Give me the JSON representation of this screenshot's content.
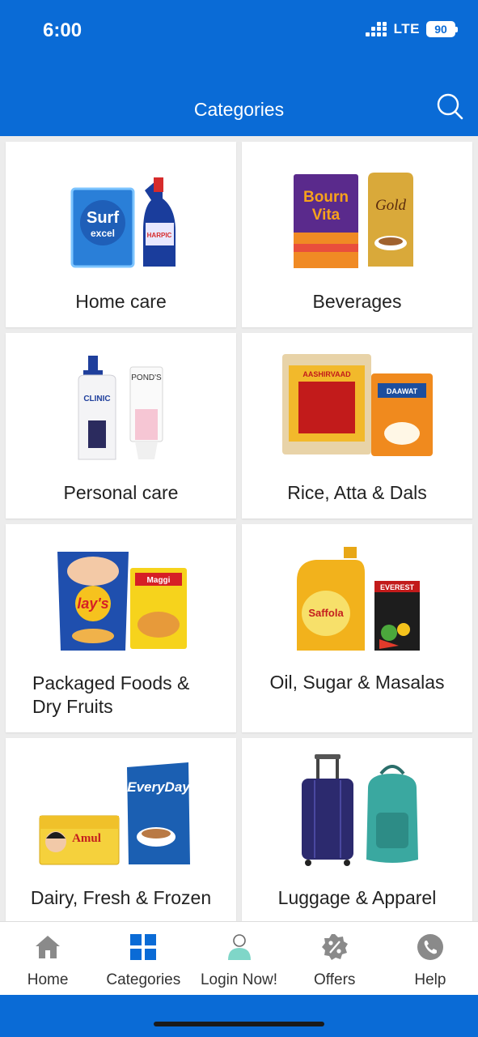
{
  "status": {
    "time": "6:00",
    "network": "LTE",
    "battery": "90"
  },
  "header": {
    "title": "Categories",
    "search_icon": "search-icon"
  },
  "categories": [
    {
      "label": "Home care"
    },
    {
      "label": "Beverages"
    },
    {
      "label": "Personal care"
    },
    {
      "label": "Rice, Atta & Dals"
    },
    {
      "label": "Packaged Foods &",
      "label_line2": "Dry Fruits"
    },
    {
      "label": "Oil, Sugar & Masalas"
    },
    {
      "label": "Dairy, Fresh & Frozen"
    },
    {
      "label": "Luggage & Apparel"
    }
  ],
  "product_text": {
    "surf": "Surf",
    "excel": "excel",
    "harpic": "HARPIC",
    "bourn": "Bourn",
    "vita": "Vita",
    "gold": "Gold",
    "ponds": "POND'S",
    "clinic": "CLINIC",
    "aashirvaad": "AASHIRVAAD",
    "daawat": "DAAWAT",
    "lays": "lay's",
    "maggi": "Maggi",
    "saffola": "Saffola",
    "everest": "EVEREST",
    "amul": "Amul",
    "everyday": "EveryDay"
  },
  "bottom_nav": [
    {
      "label": "Home",
      "icon": "home-icon"
    },
    {
      "label": "Categories",
      "icon": "grid-icon",
      "active": true
    },
    {
      "label": "Login Now!",
      "icon": "user-icon"
    },
    {
      "label": "Offers",
      "icon": "percent-badge-icon"
    },
    {
      "label": "Help",
      "icon": "phone-icon"
    }
  ],
  "colors": {
    "brand": "#0a6bd6",
    "active_nav": "#0a6bd6",
    "icon_gray": "#8a8a8a"
  }
}
